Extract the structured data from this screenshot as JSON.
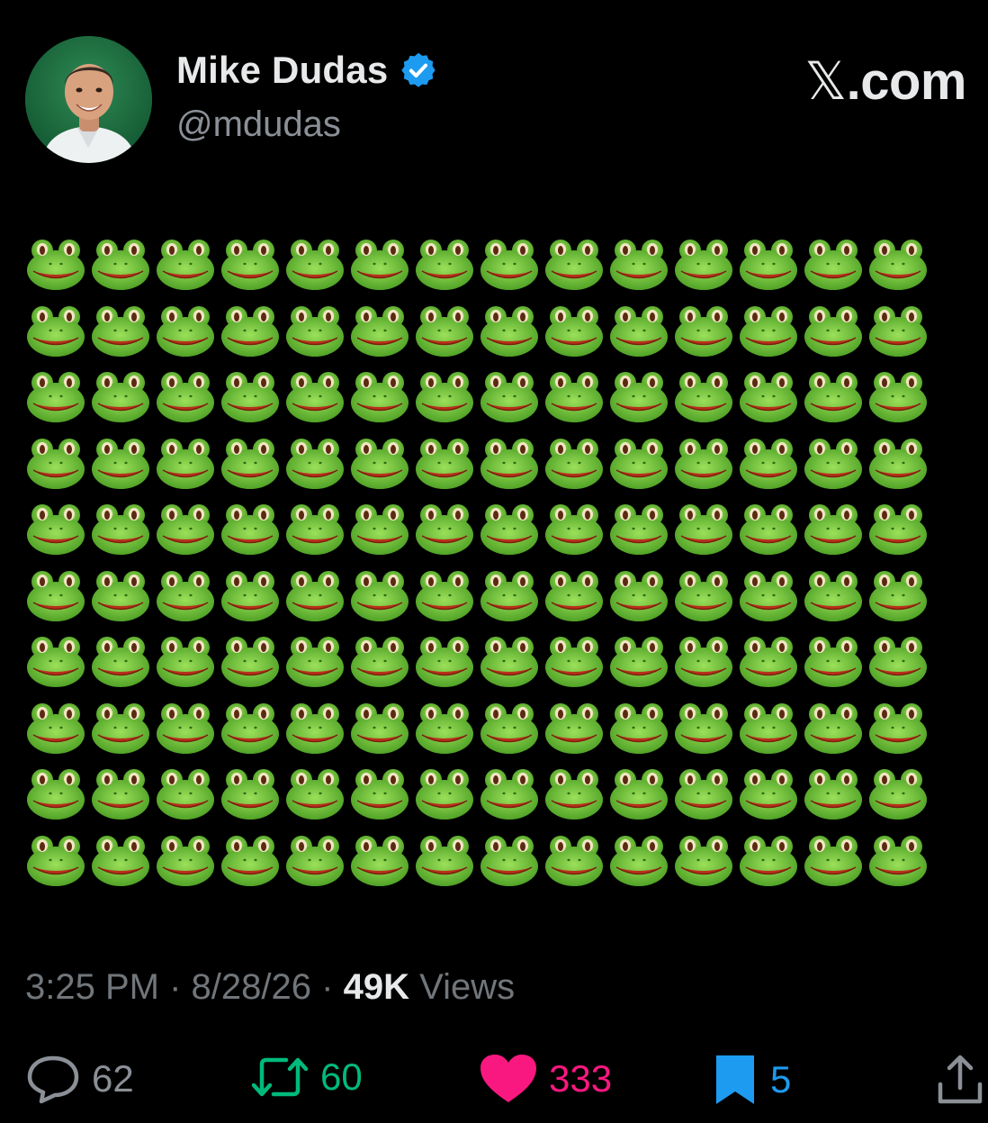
{
  "author": {
    "display_name": "Mike Dudas",
    "handle": "@mdudas",
    "verified_badge_icon": "verified-badge-icon",
    "verified_color": "#1d9bf0"
  },
  "brand": {
    "label_prefix": "𝕏",
    "label_suffix": ".com"
  },
  "post": {
    "content_emoji": "frog-face",
    "grid_rows": 10,
    "grid_columns": 14
  },
  "meta": {
    "time": "3:25 PM",
    "separator": "·",
    "date": "8/28/26",
    "views_count": "49K",
    "views_label": "Views"
  },
  "actions": {
    "reply": {
      "icon": "reply-icon",
      "count": "62",
      "color": "#8b9097"
    },
    "repost": {
      "icon": "repost-icon",
      "count": "60",
      "color": "#00ba7c"
    },
    "like": {
      "icon": "heart-icon",
      "count": "333",
      "color": "#f91880"
    },
    "bookmark": {
      "icon": "bookmark-icon",
      "count": "5",
      "color": "#1d9bf0"
    },
    "share": {
      "icon": "share-icon"
    }
  }
}
